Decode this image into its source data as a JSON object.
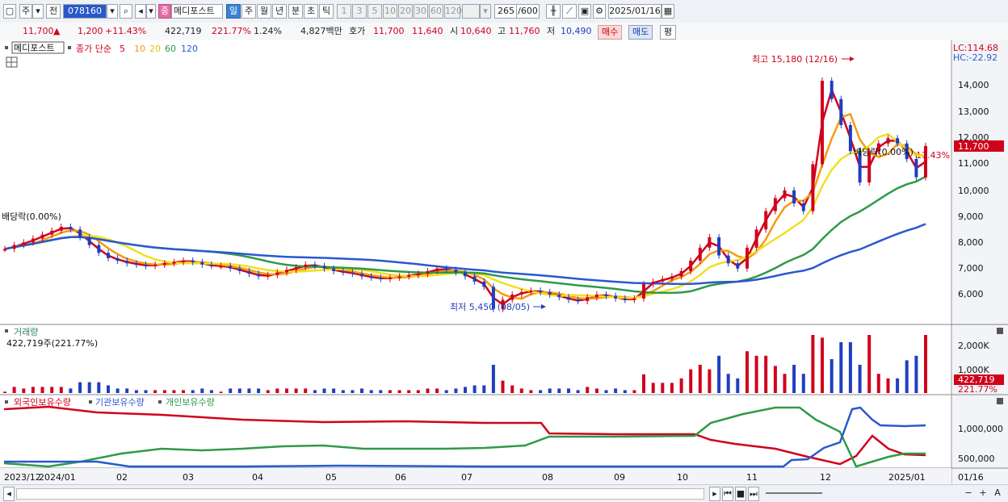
{
  "toolbar": {
    "market_label": "주",
    "market2_label": "전",
    "code_value": "078160",
    "company_label": "메디포스트",
    "period_daily": "일",
    "period_weekly": "주",
    "period_monthly": "월",
    "period_yearly": "년",
    "period_minute": "분",
    "period_second": "초",
    "period_tick": "틱",
    "intervals": [
      "1",
      "3",
      "5",
      "10",
      "20",
      "30",
      "60",
      "120"
    ],
    "count": "265",
    "count_total": "/600",
    "date": "2025/01/16",
    "jong_label": "종"
  },
  "info": {
    "price": "11,700",
    "up_arrow": "▲",
    "change": "1,200",
    "change_pct": "+11.43%",
    "volume": "422,719",
    "volume_pct": "221.77%",
    "turnover_pct": "1.24%",
    "amount": "4,827백만",
    "hoga_label": "호가",
    "ask": "11,700",
    "bid": "11,640",
    "open_label": "시",
    "open": "10,640",
    "high_label": "고",
    "high": "11,760",
    "low_label": "저",
    "low": "10,490",
    "buy_label": "매수",
    "sell_label": "매도",
    "eval_label": "평"
  },
  "legend": {
    "name": "메디포스트",
    "ma_label": "종가 단순",
    "ma": [
      {
        "period": "5",
        "color": "#d0021b"
      },
      {
        "period": "10",
        "color": "#f39c12"
      },
      {
        "period": "20",
        "color": "#f0e020"
      },
      {
        "period": "60",
        "color": "#2e9a48"
      },
      {
        "period": "120",
        "color": "#2a58d0"
      }
    ]
  },
  "annotations": {
    "lc": "LC:114.68",
    "hc": "HC:-22.92",
    "high_note": "최고 15,180 (12/16)",
    "low_note": "최저 5,450 (08/05)",
    "div_left": "배당락(0.00%)",
    "div_right": "배당락(0.00%)",
    "price_tag": "11,700",
    "pct_tag": "11.43%"
  },
  "volume_panel": {
    "title": "거래량",
    "value": "422,719주(221.77%)",
    "tag_value": "422,719",
    "tag_pct": "221.77%"
  },
  "holdings_panel": {
    "series": [
      "외국인보유수량",
      "기관보유수량",
      "개인보유수량"
    ]
  },
  "axes": {
    "price_ticks": [
      "14,000",
      "13,000",
      "12,000",
      "11,000",
      "10,000",
      "9,000",
      "8,000",
      "7,000",
      "6,000"
    ],
    "volume_ticks": [
      "2,000K",
      "1,000K"
    ],
    "holdings_ticks": [
      "1,000,000",
      "500,000"
    ],
    "x_labels": [
      "2023/12",
      "2024/01",
      "02",
      "03",
      "04",
      "05",
      "06",
      "07",
      "08",
      "09",
      "10",
      "11",
      "12",
      "2025/01",
      "01/16"
    ]
  },
  "chart_data": {
    "type": "line",
    "title": "",
    "price_axis": {
      "min": 5000,
      "max": 15180
    },
    "price_series": [
      {
        "name": "종가",
        "values": [
          7750,
          7900,
          8000,
          8150,
          8300,
          8450,
          8600,
          8500,
          8200,
          7900,
          7600,
          7400,
          7300,
          7200,
          7150,
          7100,
          7150,
          7200,
          7250,
          7300,
          7250,
          7150,
          7100,
          7100,
          7000,
          6900,
          6800,
          6700,
          6750,
          6850,
          6950,
          7050,
          7150,
          7100,
          7000,
          6900,
          6850,
          6800,
          6700,
          6650,
          6600,
          6650,
          6700,
          6750,
          6800,
          6900,
          7000,
          6950,
          6850,
          6700,
          6500,
          6300,
          5450,
          5800,
          6000,
          6100,
          6150,
          6100,
          6000,
          5900,
          5800,
          5750,
          5900,
          6000,
          5950,
          5850,
          5800,
          5850,
          6400,
          6500,
          6600,
          6700,
          6900,
          7300,
          7800,
          8200,
          7500,
          7200,
          7000,
          7800,
          8500,
          9200,
          9700,
          10000,
          9500,
          9200,
          11000,
          14200,
          13500,
          12500,
          11500,
          10300,
          11500,
          11800,
          12000,
          11800,
          11200,
          10500,
          11700
        ]
      }
    ],
    "moving_averages": [
      {
        "name": "5"
      },
      {
        "name": "10"
      },
      {
        "name": "20"
      },
      {
        "name": "60"
      },
      {
        "name": "120"
      }
    ],
    "volume_highlights_k": [
      1200,
      2450,
      1500,
      1250
    ]
  }
}
